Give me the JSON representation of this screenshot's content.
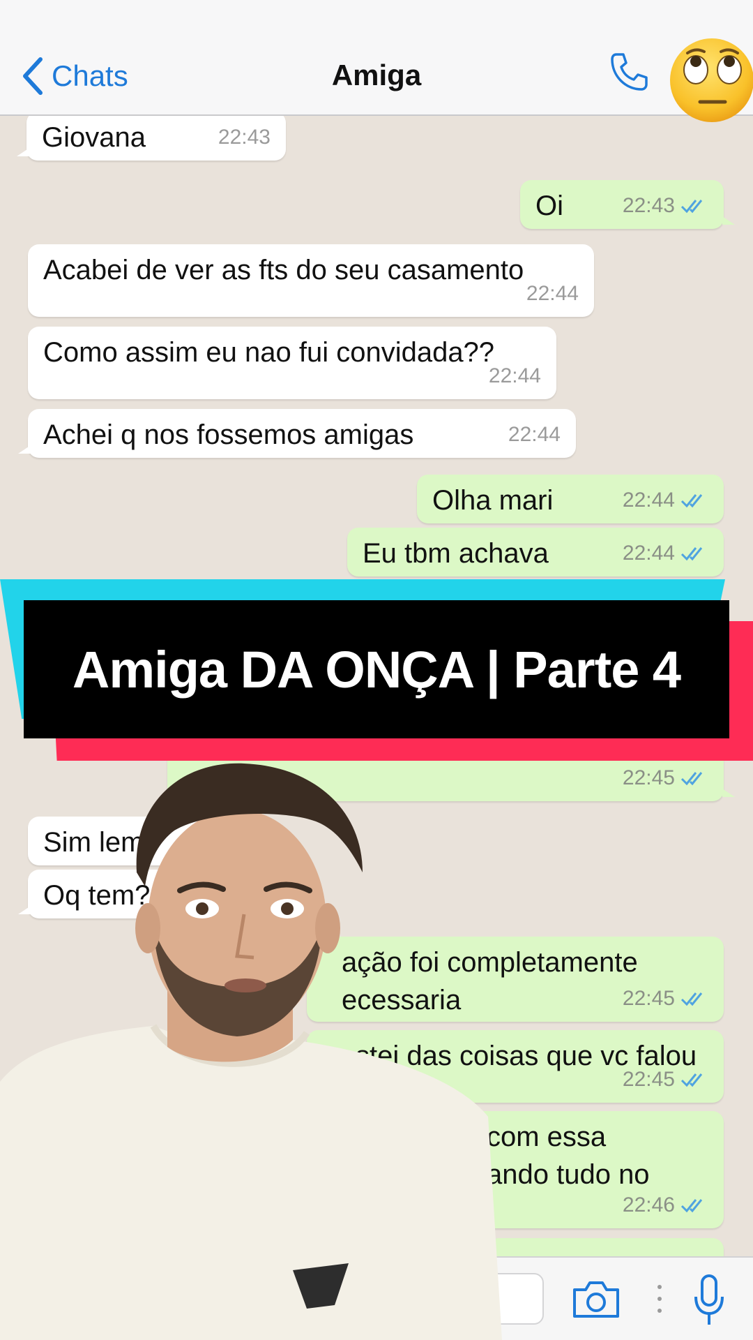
{
  "header": {
    "back_label": "Chats",
    "title": "Amiga"
  },
  "messages": [
    {
      "dir": "in",
      "text": "Giovana",
      "time": "22:43"
    },
    {
      "dir": "out",
      "text": "Oi",
      "time": "22:43"
    },
    {
      "dir": "in",
      "text": "Acabei de ver as fts do seu casamento",
      "time": "22:44"
    },
    {
      "dir": "in",
      "text": "Como assim eu nao fui convidada??",
      "time": "22:44"
    },
    {
      "dir": "in",
      "text": "Achei q nos fossemos amigas",
      "time": "22:44"
    },
    {
      "dir": "out",
      "text": "Olha mari",
      "time": "22:44"
    },
    {
      "dir": "out",
      "text": "Eu tbm achava",
      "time": "22:44"
    },
    {
      "dir": "out",
      "text": "",
      "time": "22:45"
    },
    {
      "dir": "in",
      "text": "Sim lem",
      "time": ""
    },
    {
      "dir": "in",
      "text": "Oq tem?",
      "time": ""
    },
    {
      "dir": "out",
      "text": "ação foi completamente\necessaria",
      "time": "22:45"
    },
    {
      "dir": "out",
      "text": "stei das coisas que vc falou",
      "time": "22:45"
    },
    {
      "dir": "out",
      "text": "com essa\nando tudo no",
      "time": "22:46"
    }
  ],
  "banner": {
    "text": "Amiga DA ONÇA | Parte 4"
  },
  "icons": {
    "back": "chevron-left-icon",
    "call": "phone-icon",
    "emoji": "eye-roll-emoji-icon",
    "camera": "camera-icon",
    "mic": "microphone-icon"
  },
  "colors": {
    "accent": "#1e7ad9",
    "outgoing_bubble": "#dcf8c6",
    "incoming_bubble": "#ffffff",
    "chat_background": "#e9e2da",
    "banner_cyan": "#22d3ea",
    "banner_red": "#fe2c55",
    "read_ticks": "#4fa3e0"
  }
}
